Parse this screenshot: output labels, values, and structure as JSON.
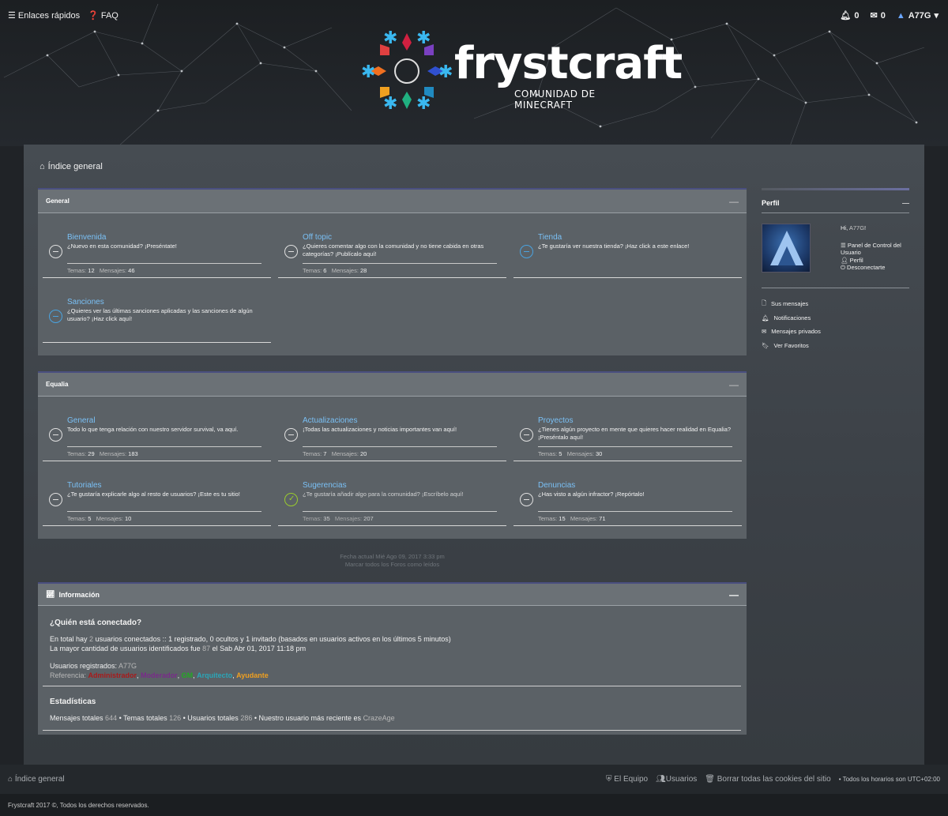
{
  "topbar": {
    "quick_links": "Enlaces rápidos",
    "faq": "FAQ",
    "notifications_count": "0",
    "messages_count": "0",
    "username": "A77G"
  },
  "logo": {
    "title": "frystcraft",
    "subtitle": "COMUNIDAD DE MINECRAFT"
  },
  "breadcrumb": "Índice general",
  "sections": [
    {
      "title": "General",
      "forums": [
        {
          "name": "Bienvenida",
          "desc": "¿Nuevo en esta comunidad? ¡Preséntate!",
          "topics_label": "Temas:",
          "topics": "12",
          "posts_label": "Mensajes:",
          "posts": "46"
        },
        {
          "name": "Off topic",
          "desc": "¿Quieres comentar algo con la comunidad y no tiene cabida en otras categorías? ¡Publícalo aquí!",
          "topics_label": "Temas:",
          "topics": "6",
          "posts_label": "Mensajes:",
          "posts": "28"
        },
        {
          "name": "Tienda",
          "desc": "¿Te gustaría ver nuestra tienda? ¡Haz click a este enlace!"
        },
        {
          "name": "Sanciones",
          "desc": "¿Quieres ver las últimas sanciones aplicadas y las sanciones de algún usuario? ¡Haz click aquí!"
        }
      ]
    },
    {
      "title": "Equalia",
      "forums": [
        {
          "name": "General",
          "desc": "Todo lo que tenga relación con nuestro servidor survival, va aquí.",
          "topics_label": "Temas:",
          "topics": "29",
          "posts_label": "Mensajes:",
          "posts": "183"
        },
        {
          "name": "Actualizaciones",
          "desc": "¡Todas las actualizaciones y noticias importantes van aquí!",
          "topics_label": "Temas:",
          "topics": "7",
          "posts_label": "Mensajes:",
          "posts": "20"
        },
        {
          "name": "Proyectos",
          "desc": "¿Tienes algún proyecto en mente que quieres hacer realidad en Equalia? ¡Preséntalo aquí!",
          "topics_label": "Temas:",
          "topics": "5",
          "posts_label": "Mensajes:",
          "posts": "30"
        },
        {
          "name": "Tutoriales",
          "desc": "¿Te gustaría explicarle algo al resto de usuarios? ¡Este es tu sitio!",
          "topics_label": "Temas:",
          "topics": "5",
          "posts_label": "Mensajes:",
          "posts": "10"
        },
        {
          "name": "Sugerencias",
          "desc": "¿Te gustaría añadir algo para la comunidad? ¡Escríbelo aquí!",
          "topics_label": "Temas:",
          "topics": "35",
          "posts_label": "Mensajes:",
          "posts": "207"
        },
        {
          "name": "Denuncias",
          "desc": "¿Has visto a algún infractor? ¡Repórtalo!",
          "topics_label": "Temas:",
          "topics": "15",
          "posts_label": "Mensajes:",
          "posts": "71"
        }
      ]
    }
  ],
  "date_line": "Fecha actual Mié Ago 09, 2017 3:33 pm",
  "mark_read": "Marcar todos los Foros como leídos",
  "info": {
    "title": "Información",
    "who_online": "¿Quién está conectado?",
    "online_line_1a": "En total hay ",
    "online_count": "2",
    "online_line_1b": " usuarios conectados :: 1 registrado, 0 ocultos y 1 invitado (basados en usuarios activos en los últimos 5 minutos)",
    "online_line_2a": "La mayor cantidad de usuarios identificados fue ",
    "online_max": "87",
    "online_line_2b": " el Sab Abr 01, 2017 11:18 pm",
    "registered_label": "Usuarios registrados: ",
    "registered_user": "A77G",
    "legend_label": "Referencia: ",
    "legend": [
      {
        "name": "Administrador",
        "color": "#aa1a1a"
      },
      {
        "name": "Moderador",
        "color": "#7a2a8a"
      },
      {
        "name": "GM",
        "color": "#22aa22"
      },
      {
        "name": "Arquitecto",
        "color": "#2aa6b8"
      },
      {
        "name": "Ayudante",
        "color": "#f0a020"
      }
    ],
    "stats_title": "Estadísticas",
    "stats_a": "Mensajes totales ",
    "stats_posts": "644",
    "stats_b": " • Temas totales ",
    "stats_topics": "126",
    "stats_c": " • Usuarios totales ",
    "stats_users": "286",
    "stats_d": " • Nuestro usuario más reciente es ",
    "stats_newest": "CrazeAge"
  },
  "sidebar": {
    "title": "Perfil",
    "greeting_a": "Hi, ",
    "greeting_user": "A77G",
    "greeting_b": "!",
    "ucp": "Panel de Control del Usuario",
    "profile": "Perfil",
    "logout": "Desconectarte",
    "menu": [
      "Sus mensajes",
      "Notificaciones",
      "Mensajes privados",
      "Ver Favoritos"
    ]
  },
  "footer": {
    "index": "Índice general",
    "team": "El Equipo",
    "users": "Usuarios",
    "delete_cookies": "Borrar todas las cookies del sitio",
    "timezone": "• Todos los horarios son UTC+02:00",
    "copyright": "Frystcraft 2017 ©, Todos los derechos reservados."
  }
}
